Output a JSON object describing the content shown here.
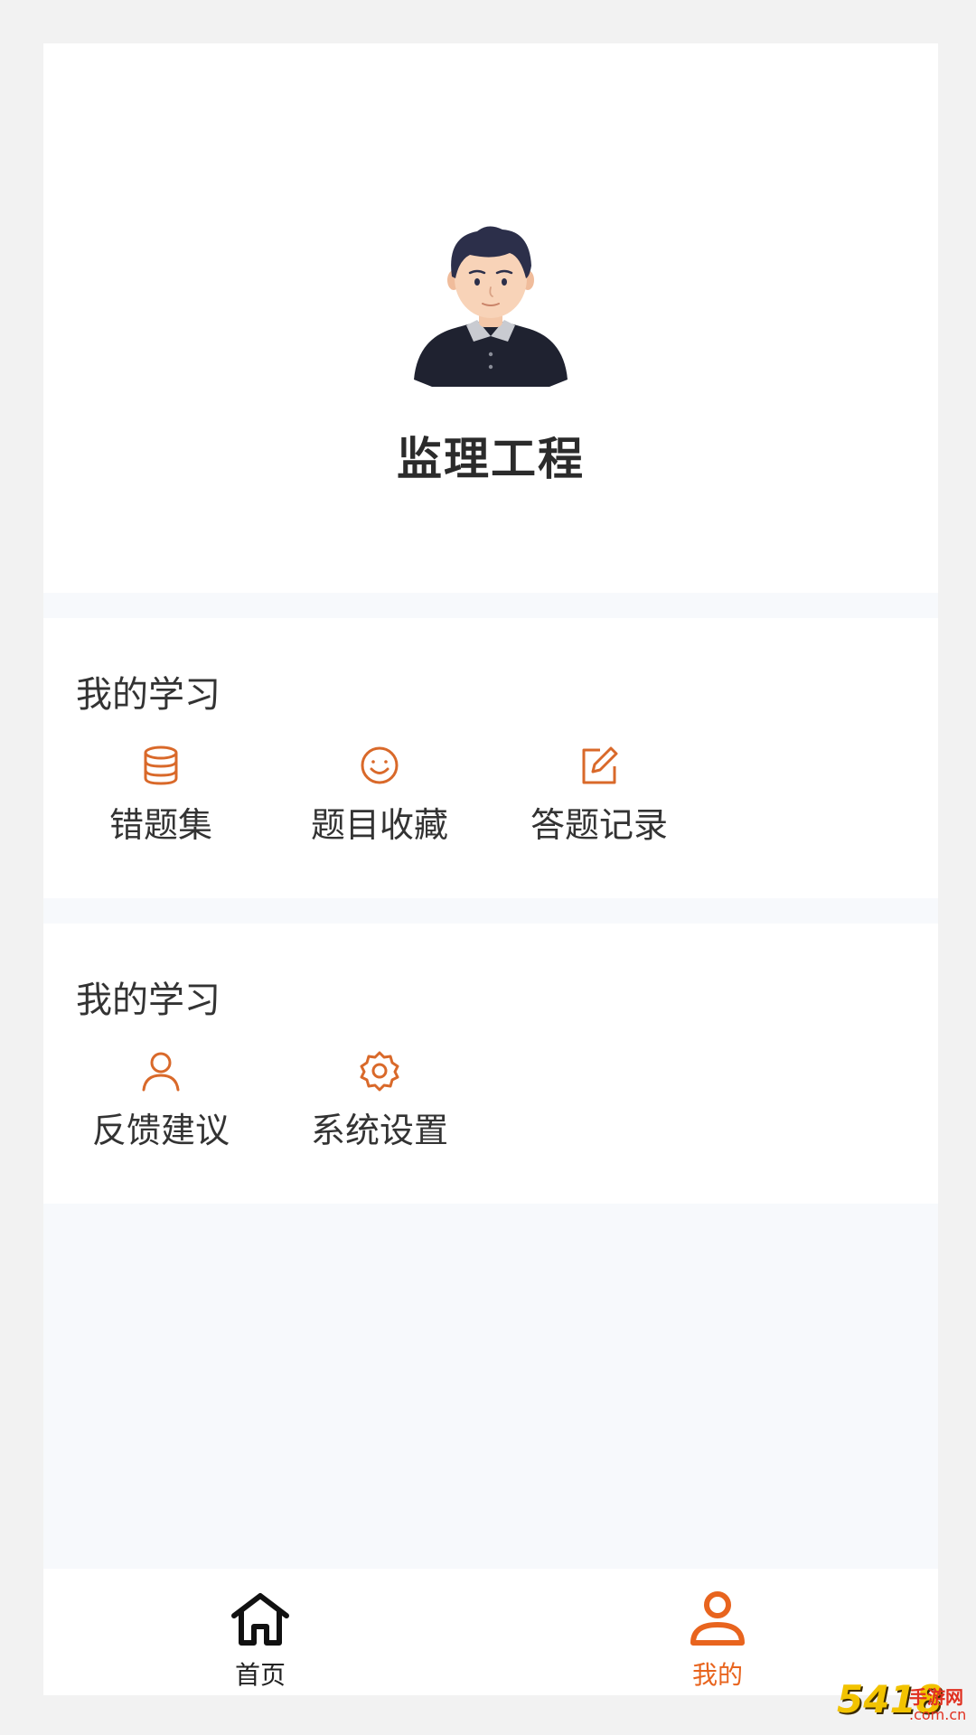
{
  "profile": {
    "name": "监理工程"
  },
  "sections": [
    {
      "title": "我的学习",
      "items": [
        {
          "label": "错题集",
          "icon": "database-icon"
        },
        {
          "label": "题目收藏",
          "icon": "smile-icon"
        },
        {
          "label": "答题记录",
          "icon": "edit-icon"
        }
      ]
    },
    {
      "title": "我的学习",
      "items": [
        {
          "label": "反馈建议",
          "icon": "user-icon"
        },
        {
          "label": "系统设置",
          "icon": "gear-icon"
        }
      ]
    }
  ],
  "tab_bar": {
    "home_label": "首页",
    "mine_label": "我的",
    "active": "mine"
  },
  "colors": {
    "accent": "#e8641e",
    "icon": "#d9692a"
  },
  "watermark": {
    "main": "5418",
    "sub": "手游网",
    "domain": ".com.cn"
  }
}
